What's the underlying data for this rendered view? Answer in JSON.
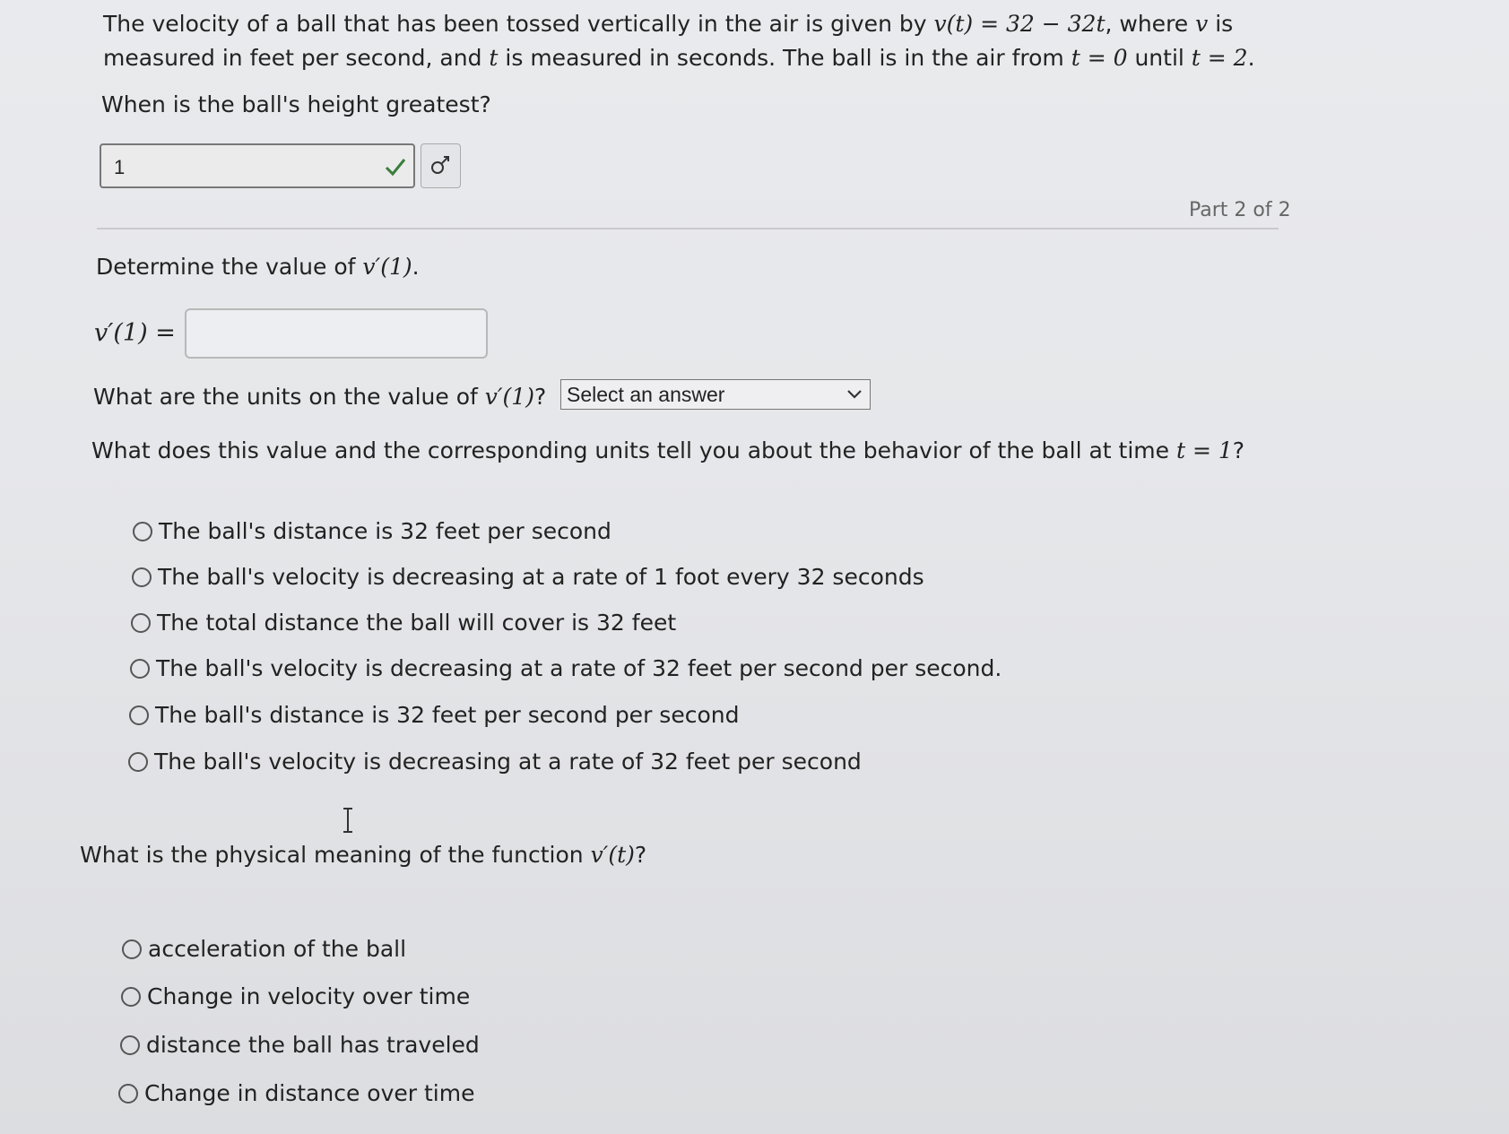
{
  "part1": {
    "intro_a": "The velocity of a ball that has been tossed vertically in the air is given by ",
    "intro_eq": "v(t) = 32 − 32t",
    "intro_b": ", where ",
    "intro_v": "v",
    "intro_c": " is",
    "line2_a": "measured in feet per second, and ",
    "line2_t": "t",
    "line2_b": " is measured in seconds. The ball is in the air from ",
    "line2_eq1": "t = 0",
    "line2_c": " until ",
    "line2_eq2": "t = 2",
    "line2_d": ".",
    "question": "When is the ball's height greatest?",
    "answer_value": "1"
  },
  "part_label": "Part 2 of 2",
  "part2": {
    "determine_a": "Determine the value of ",
    "determine_eq": "v′(1)",
    "determine_b": ".",
    "input_label": "v′(1) =",
    "input_value": "",
    "units_q_a": "What are the units on the value of ",
    "units_q_eq": "v′(1)",
    "units_q_b": "?",
    "select_value": "Select an answer",
    "behavior_q_a": "What does this value and the corresponding units tell you about the behavior of the ball at time ",
    "behavior_q_eq": "t = 1",
    "behavior_q_b": "?",
    "behavior_options": [
      "The ball's distance is 32 feet per second",
      "The ball's velocity is decreasing at a rate of 1 foot every 32 seconds",
      "The total distance the ball will cover is 32 feet",
      "The ball's velocity is decreasing at a rate of 32 feet per second per second.",
      "The ball's distance is 32 feet per second per second",
      "The ball's velocity is decreasing at a rate of 32 feet per second"
    ],
    "meaning_q_a": "What is the physical meaning of the function ",
    "meaning_q_eq": "v′(t)",
    "meaning_q_b": "?",
    "meaning_options": [
      "acceleration of the ball",
      "Change in velocity over time",
      "distance the ball has traveled",
      "Change in distance over time"
    ]
  },
  "icons": {
    "check": "check-icon",
    "preview": "equation-preview-icon",
    "dropdown": "chevron-down-icon",
    "cursor": "text-cursor-icon"
  },
  "colors": {
    "check_green": "#3a7d3c",
    "text": "#222222",
    "muted": "#666666"
  }
}
